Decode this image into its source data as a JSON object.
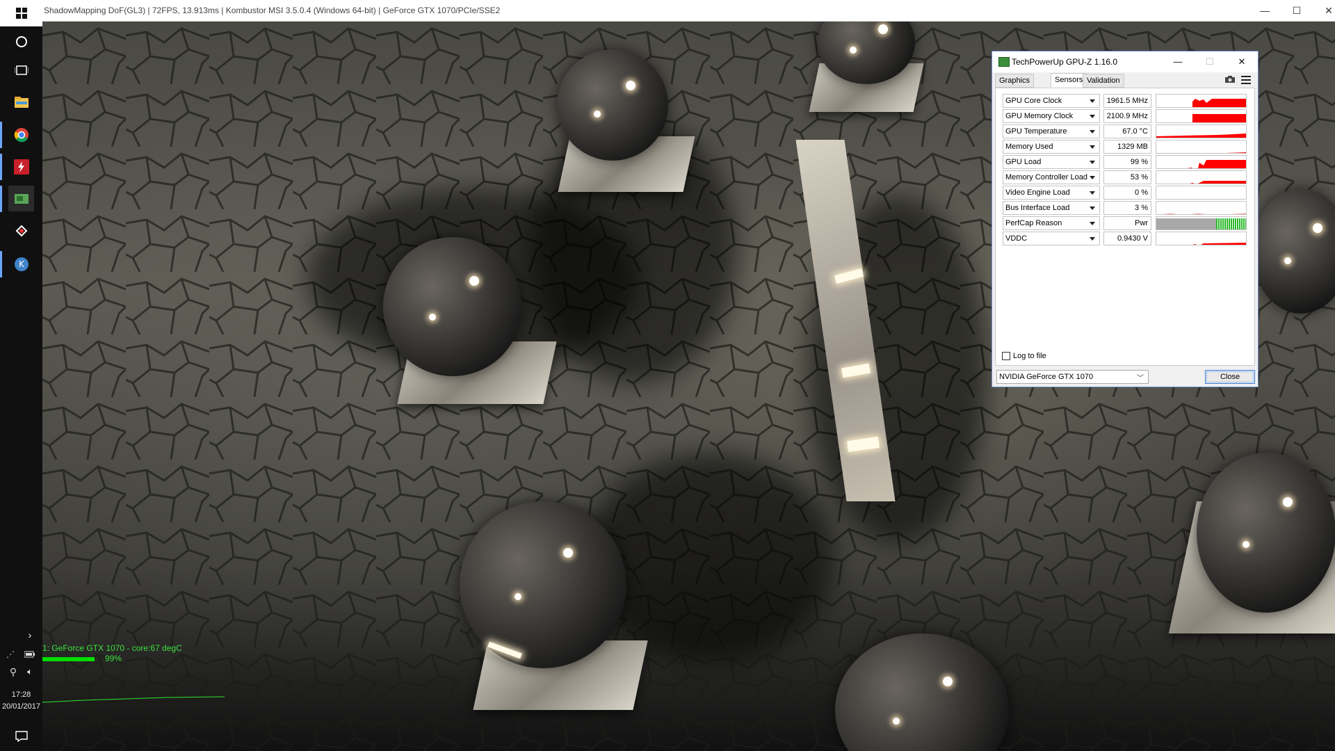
{
  "window": {
    "title": "ShadowMapping DoF(GL3) | 72FPS, 13.913ms | Kombustor MSI 3.5.0.4 (Windows 64-bit) | GeForce GTX 1070/PCIe/SSE2"
  },
  "taskbar": {
    "time": "17:28",
    "date": "20/01/2017"
  },
  "hud": {
    "gpu_line": "1: GeForce GTX 1070 - core:67 degC",
    "load_percent": "99%",
    "load_level": 0.99
  },
  "gpuz": {
    "title": "TechPowerUp GPU-Z 1.16.0",
    "tabs": [
      "Graphics Card",
      "Sensors",
      "Validation"
    ],
    "active_tab": "Sensors",
    "sensors": [
      {
        "name": "GPU Core Clock",
        "value": "1961.5 MHz"
      },
      {
        "name": "GPU Memory Clock",
        "value": "2100.9 MHz"
      },
      {
        "name": "GPU Temperature",
        "value": "67.0 °C"
      },
      {
        "name": "Memory Used",
        "value": "1329 MB"
      },
      {
        "name": "GPU Load",
        "value": "99 %"
      },
      {
        "name": "Memory Controller Load",
        "value": "53 %"
      },
      {
        "name": "Video Engine Load",
        "value": "0 %"
      },
      {
        "name": "Bus Interface Load",
        "value": "3 %"
      },
      {
        "name": "PerfCap Reason",
        "value": "Pwr"
      },
      {
        "name": "VDDC",
        "value": "0.9430 V"
      }
    ],
    "log_label": "Log to file",
    "device_select": "NVIDIA GeForce GTX 1070",
    "close_label": "Close",
    "graph_color": "#ff0000"
  }
}
